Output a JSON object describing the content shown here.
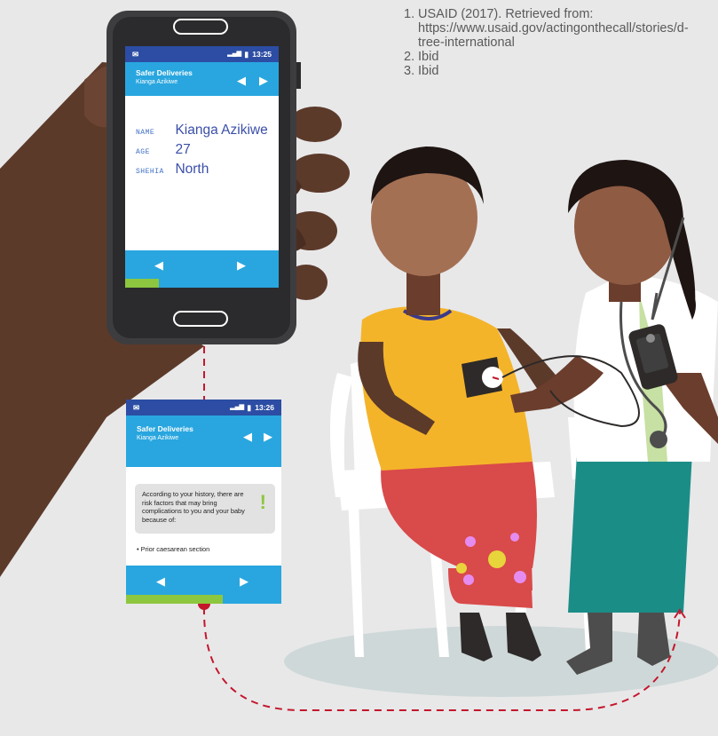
{
  "footnotes": [
    {
      "num": "1.",
      "text": "USAID (2017). Retrieved from: https://www.usaid.gov/actingonthecall/stories/d-tree-international"
    },
    {
      "num": "2.",
      "text": "Ibid"
    },
    {
      "num": "3.",
      "text": "Ibid"
    }
  ],
  "phone_screen": {
    "time": "13:25",
    "app_title": "Safer Deliveries",
    "patient_name_header": "Kianga Azikiwe",
    "fields": [
      {
        "label": "NAME",
        "value": "Kianga Azikiwe"
      },
      {
        "label": "AGE",
        "value": "27"
      },
      {
        "label": "SHEHIA",
        "value": "North"
      }
    ],
    "progress": 0.22
  },
  "detail_screen": {
    "time": "13:26",
    "app_title": "Safer Deliveries",
    "patient_name_header": "Kianga Azikiwe",
    "alert_text": "According to your history, there are risk factors that may bring complications to you and your baby because of:",
    "alert_mark": "!",
    "risk_factors": [
      "• Prior caesarean section"
    ],
    "progress": 0.62
  },
  "icons": {
    "mail": "✉",
    "signal": "▂▄▆",
    "battery": "▮",
    "nav_left": "◀",
    "nav_right": "▶"
  },
  "colors": {
    "status_bar": "#2c4da3",
    "app_bar": "#29a6df",
    "progress": "#8dc63f",
    "label_text": "#3f6fc7",
    "value_text": "#3b4fa8",
    "background": "#e8e8e9",
    "dashed_path": "#c4172c"
  }
}
